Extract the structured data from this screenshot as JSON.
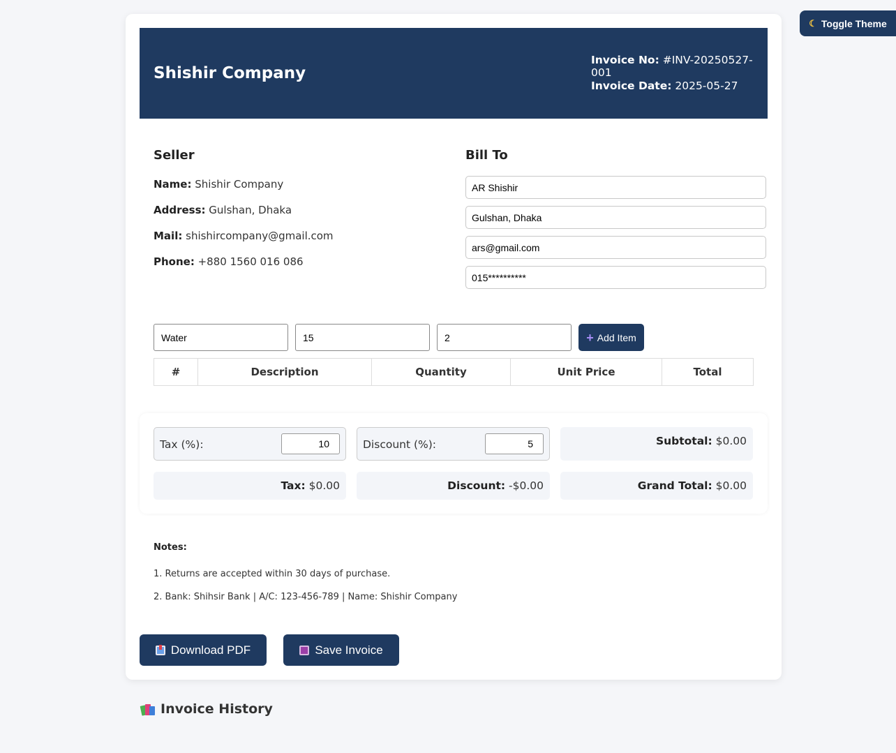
{
  "toggle_theme": {
    "label": "Toggle Theme",
    "icon": "moon-icon"
  },
  "header": {
    "company_name": "Shishir Company",
    "invoice_no_label": "Invoice No:",
    "invoice_no": "#INV-20250527-001",
    "invoice_date_label": "Invoice Date:",
    "invoice_date": "2025-05-27"
  },
  "seller": {
    "title": "Seller",
    "name_label": "Name:",
    "name": "Shishir Company",
    "address_label": "Address:",
    "address": "Gulshan, Dhaka",
    "mail_label": "Mail:",
    "mail": "shishircompany@gmail.com",
    "phone_label": "Phone:",
    "phone": "+880 1560 016 086"
  },
  "bill_to": {
    "title": "Bill To",
    "name": "AR Shishir",
    "address": "Gulshan, Dhaka",
    "email": "ars@gmail.com",
    "phone": "015**********"
  },
  "item_entry": {
    "description": "Water",
    "quantity": "15",
    "unit_price": "2",
    "add_label": "Add Item"
  },
  "table": {
    "columns": [
      "#",
      "Description",
      "Quantity",
      "Unit Price",
      "Total"
    ]
  },
  "totals": {
    "tax_label": "Tax (%):",
    "tax_value": "10",
    "discount_label": "Discount (%):",
    "discount_value": "5",
    "subtotal_label": "Subtotal:",
    "subtotal": "$0.00",
    "tax_amount_label": "Tax:",
    "tax_amount": "$0.00",
    "discount_amount_label": "Discount:",
    "discount_amount": "-$0.00",
    "grand_total_label": "Grand Total:",
    "grand_total": "$0.00"
  },
  "notes": {
    "title": "Notes:",
    "lines": [
      "1. Returns are accepted within 30 days of purchase.",
      "2. Bank: Shihsir Bank | A/C: 123-456-789 | Name: Shishir Company"
    ]
  },
  "actions": {
    "download_label": "Download PDF",
    "save_label": "Save Invoice"
  },
  "history": {
    "title": "Invoice History"
  },
  "colors": {
    "primary": "#1f3a60",
    "background": "#f5f6f9",
    "panel": "#f3f5f9"
  }
}
